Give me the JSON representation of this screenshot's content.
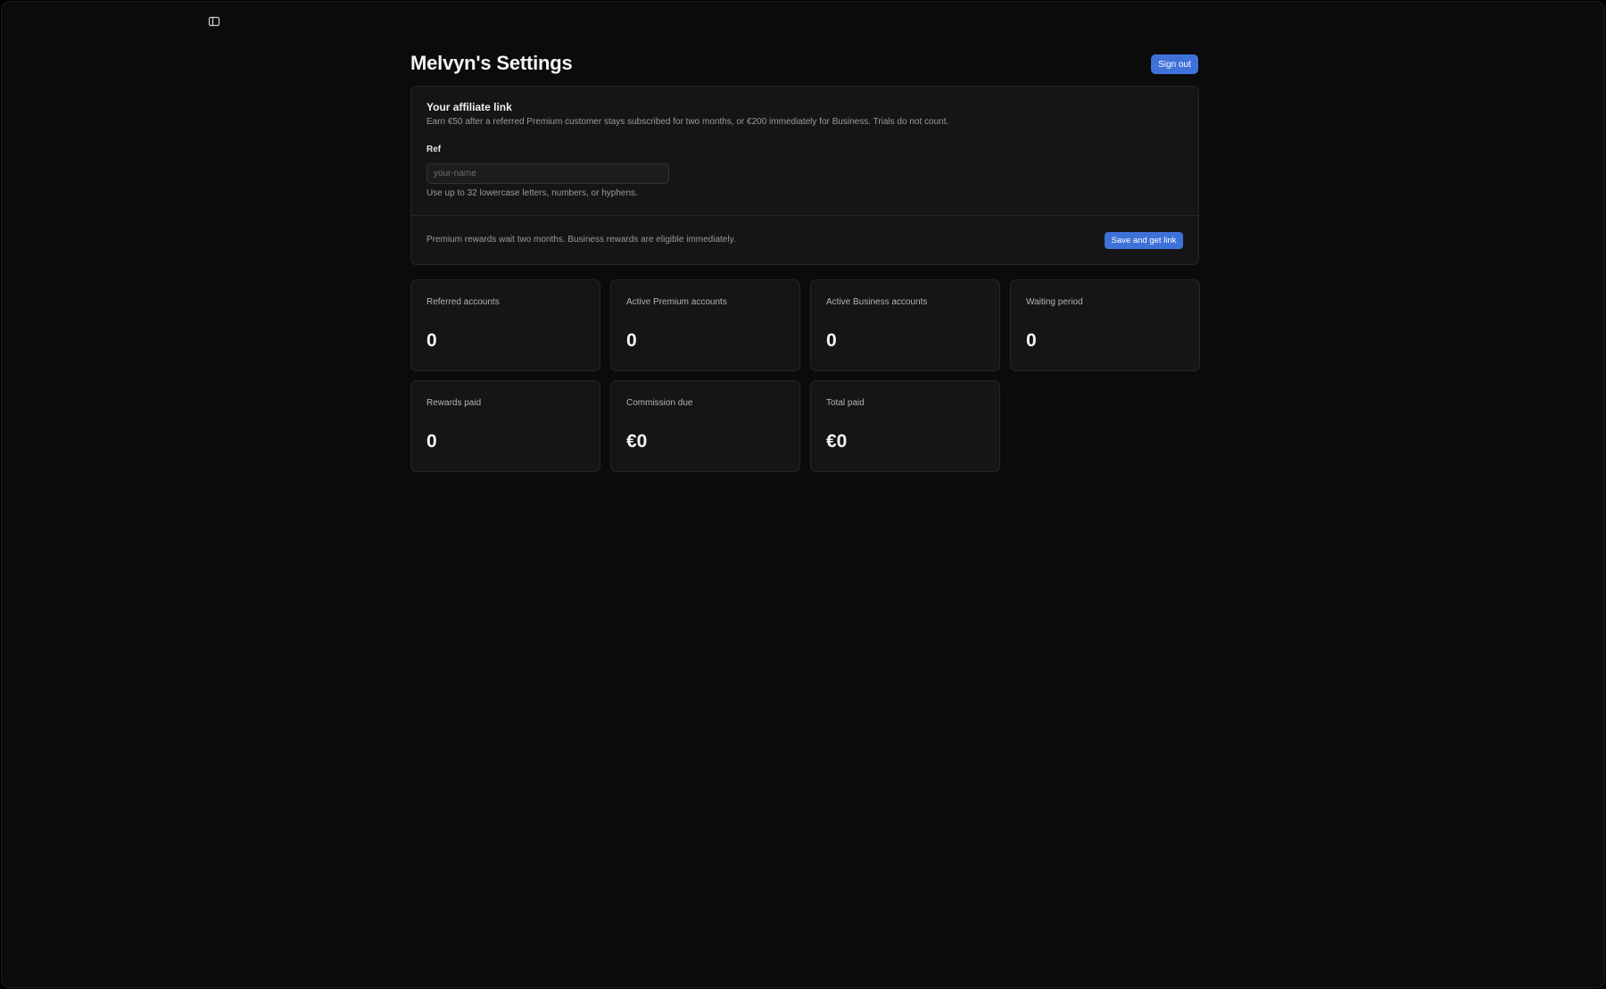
{
  "header": {
    "title": "Melvyn's Settings",
    "sign_out_label": "Sign out"
  },
  "affiliate": {
    "title": "Your affiliate link",
    "description": "Earn €50 after a referred Premium customer stays subscribed for two months, or €200 immediately for Business. Trials do not count.",
    "ref_label": "Ref",
    "ref_placeholder": "your-name",
    "ref_value": "",
    "ref_hint": "Use up to 32 lowercase letters, numbers, or hyphens.",
    "footer_note": "Premium rewards wait two months. Business rewards are eligible immediately.",
    "save_label": "Save and get link"
  },
  "stats": [
    {
      "label": "Referred accounts",
      "value": "0"
    },
    {
      "label": "Active Premium accounts",
      "value": "0"
    },
    {
      "label": "Active Business accounts",
      "value": "0"
    },
    {
      "label": "Waiting period",
      "value": "0"
    },
    {
      "label": "Rewards paid",
      "value": "0"
    },
    {
      "label": "Commission due",
      "value": "€0"
    },
    {
      "label": "Total paid",
      "value": "€0"
    }
  ],
  "icons": {
    "sidebar_toggle": "sidebar-toggle-icon"
  },
  "colors": {
    "accent": "#3f72d9",
    "background": "#0b0b0b",
    "card": "#151515"
  }
}
